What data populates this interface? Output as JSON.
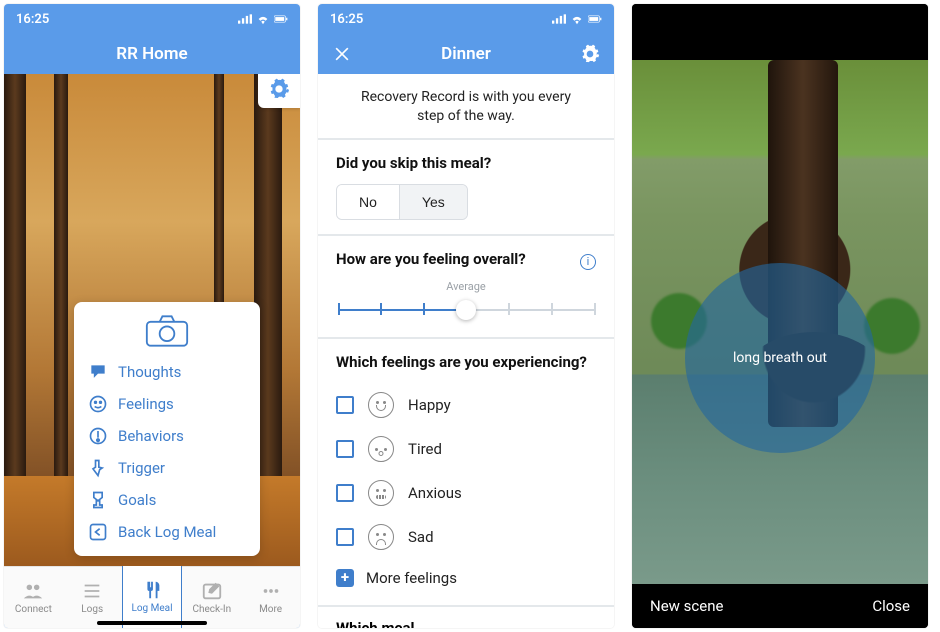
{
  "status": {
    "time": "16:25"
  },
  "colors": {
    "accent": "#3f7ecb",
    "header": "#5a9be9"
  },
  "screen1": {
    "title": "RR Home",
    "card": {
      "items": [
        {
          "icon": "thought-icon",
          "label": "Thoughts"
        },
        {
          "icon": "feelings-icon",
          "label": "Feelings"
        },
        {
          "icon": "behaviors-icon",
          "label": "Behaviors"
        },
        {
          "icon": "trigger-icon",
          "label": "Trigger"
        },
        {
          "icon": "goals-icon",
          "label": "Goals"
        },
        {
          "icon": "backlog-icon",
          "label": "Back Log Meal"
        }
      ]
    },
    "tabs": [
      {
        "label": "Connect"
      },
      {
        "label": "Logs"
      },
      {
        "label": "Log Meal"
      },
      {
        "label": "Check-In"
      },
      {
        "label": "More"
      }
    ],
    "active_tab": 2
  },
  "screen2": {
    "title": "Dinner",
    "intro": "Recovery Record is with you every step of the way.",
    "q_skip": {
      "question": "Did you skip this meal?",
      "options": [
        "No",
        "Yes"
      ]
    },
    "q_feel": {
      "question": "How are you feeling overall?",
      "slider_label": "Average",
      "slider_value": 0.5
    },
    "q_feelings": {
      "question": "Which feelings are you experiencing?",
      "options": [
        "Happy",
        "Tired",
        "Anxious",
        "Sad"
      ],
      "more_label": "More feelings"
    },
    "q_cutoff": "Which meal"
  },
  "screen3": {
    "breath_text": "long breath out",
    "btn_left": "New scene",
    "btn_right": "Close"
  }
}
